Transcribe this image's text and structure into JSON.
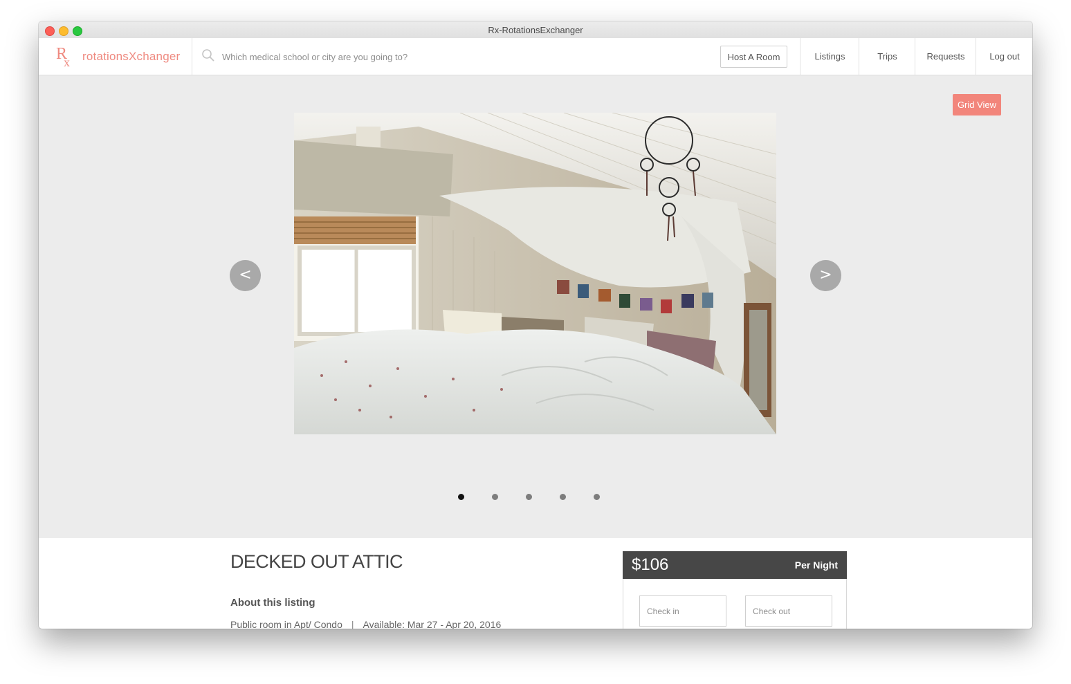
{
  "window": {
    "title": "Rx-RotationsExchanger"
  },
  "brand": {
    "mark": "Rx",
    "name": "rotationsXchanger",
    "color": "#ef8a80"
  },
  "search": {
    "placeholder": "Which medical school or city are you going to?",
    "icon": "search-icon"
  },
  "nav": {
    "host_label": "Host A Room",
    "items": [
      "Listings",
      "Trips",
      "Requests",
      "Log out"
    ]
  },
  "gallery": {
    "view_toggle_label": "Grid View",
    "prev_label": "<",
    "next_label": ">",
    "slide_count": 5,
    "active_slide": 1
  },
  "listing": {
    "title": "DECKED OUT ATTIC",
    "about_heading": "About this listing",
    "room_type": "Public room in Apt/ Condo",
    "separator": "|",
    "availability": "Available: Mar 27 - Apr 20, 2016"
  },
  "booking": {
    "price": "$106",
    "unit": "Per Night",
    "check_in_placeholder": "Check in",
    "check_out_placeholder": "Check out"
  },
  "colors": {
    "accent": "#f2857b",
    "price_bar": "#474747",
    "page_bg": "#ececec"
  }
}
